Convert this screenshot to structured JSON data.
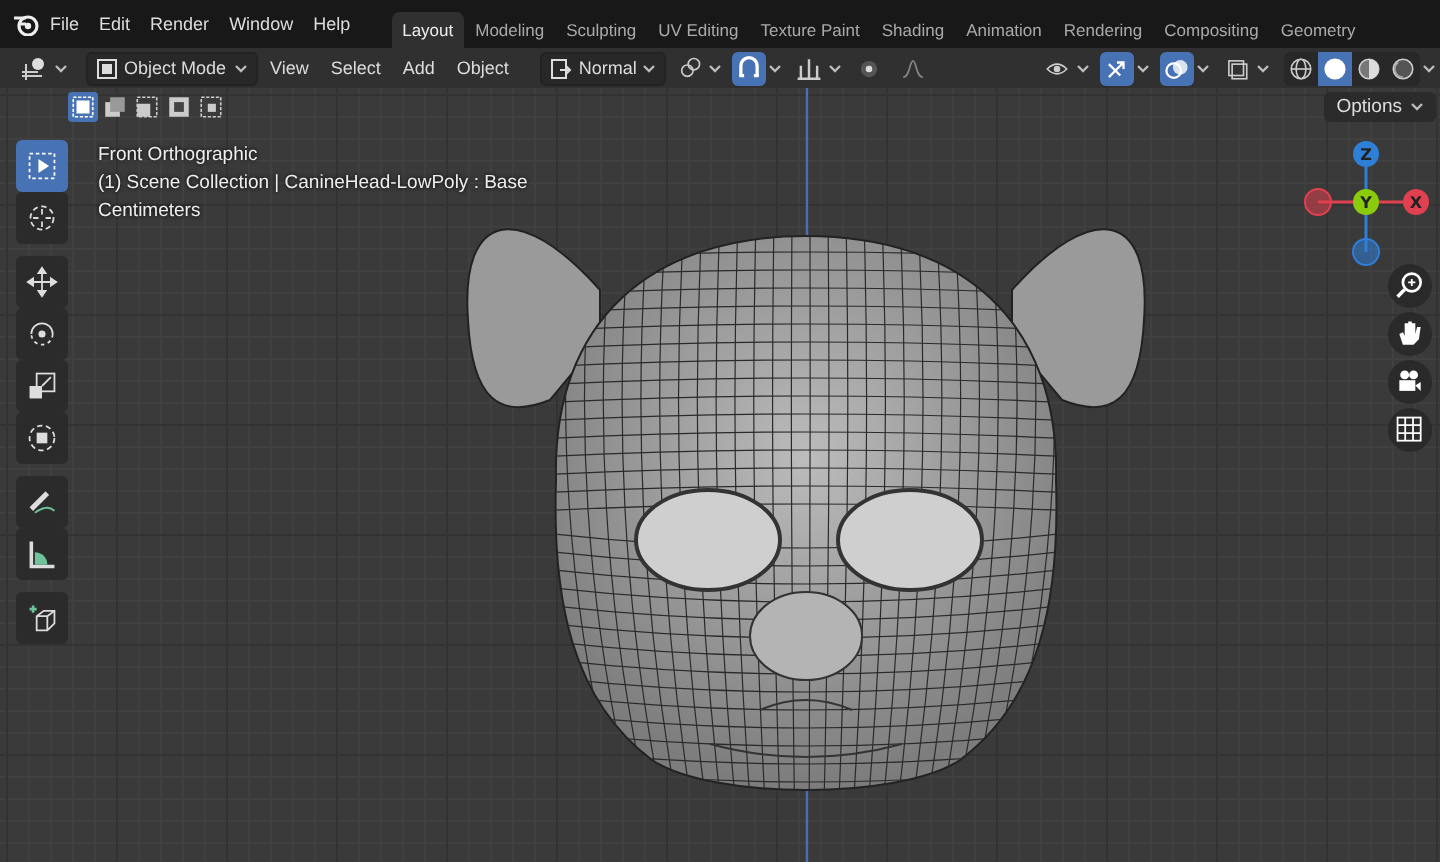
{
  "menu": [
    "File",
    "Edit",
    "Render",
    "Window",
    "Help"
  ],
  "workspace_tabs": [
    {
      "label": "Layout",
      "selected": true
    },
    {
      "label": "Modeling",
      "selected": false
    },
    {
      "label": "Sculpting",
      "selected": false
    },
    {
      "label": "UV Editing",
      "selected": false
    },
    {
      "label": "Texture Paint",
      "selected": false
    },
    {
      "label": "Shading",
      "selected": false
    },
    {
      "label": "Animation",
      "selected": false
    },
    {
      "label": "Rendering",
      "selected": false
    },
    {
      "label": "Compositing",
      "selected": false
    },
    {
      "label": "Geometry",
      "selected": false
    }
  ],
  "header": {
    "mode": "Object Mode",
    "menus": [
      "View",
      "Select",
      "Add",
      "Object"
    ],
    "orientation": "Normal"
  },
  "tool_toggles": [
    {
      "kind": "pivot",
      "selected": false
    },
    {
      "kind": "snap",
      "selected": true
    },
    {
      "kind": "snap-target",
      "selected": false
    },
    {
      "kind": "proportional",
      "selected": false
    },
    {
      "kind": "falloff",
      "selected": false
    }
  ],
  "view_toggles": [
    {
      "kind": "visibility",
      "selected": false
    },
    {
      "kind": "gizmos",
      "selected": true
    },
    {
      "kind": "overlays",
      "selected": true
    },
    {
      "kind": "xray",
      "selected": false
    }
  ],
  "shading_modes": [
    {
      "kind": "wireframe",
      "selected": false
    },
    {
      "kind": "solid",
      "selected": true
    },
    {
      "kind": "material",
      "selected": false
    },
    {
      "kind": "rendered",
      "selected": false
    }
  ],
  "select_modes": [
    {
      "kind": "new",
      "selected": true
    },
    {
      "kind": "extend",
      "selected": false
    },
    {
      "kind": "subtract",
      "selected": false
    },
    {
      "kind": "invert",
      "selected": false
    },
    {
      "kind": "intersect",
      "selected": false
    }
  ],
  "options": "Options",
  "overlay_text": [
    "Front Orthographic",
    "(1) Scene Collection | CanineHead-LowPoly : Base",
    "Centimeters"
  ],
  "tool_groups": [
    {
      "tools": [
        {
          "kind": "select",
          "selected": true
        },
        {
          "kind": "cursor",
          "selected": false
        }
      ]
    },
    {
      "tools": [
        {
          "kind": "move",
          "selected": false
        },
        {
          "kind": "rotate",
          "selected": false
        },
        {
          "kind": "scale",
          "selected": false
        },
        {
          "kind": "transform",
          "selected": false
        }
      ]
    },
    {
      "tools": [
        {
          "kind": "annotate",
          "selected": false
        },
        {
          "kind": "measure",
          "selected": false
        }
      ]
    },
    {
      "tools": [
        {
          "kind": "add-cube",
          "selected": false
        }
      ]
    }
  ],
  "gizmo": {
    "axes": [
      {
        "label": "Z",
        "color": "#2e7fd8"
      },
      {
        "label": "Y",
        "color": "#8bcb0d"
      },
      {
        "label": "X",
        "color": "#e0404f"
      }
    ]
  },
  "nav_buttons": [
    {
      "kind": "zoom"
    },
    {
      "kind": "pan"
    },
    {
      "kind": "camera"
    },
    {
      "kind": "grid"
    }
  ]
}
